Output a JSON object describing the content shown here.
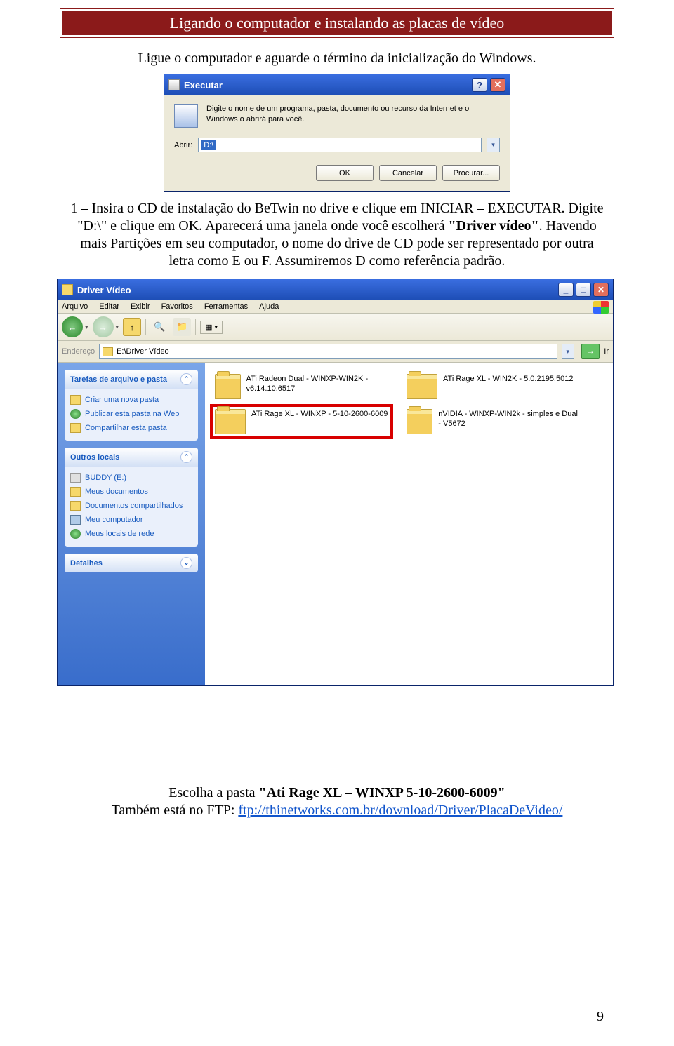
{
  "header": {
    "title": "Ligando o computador e instalando as placas de vídeo"
  },
  "intro": "Ligue o computador e aguarde o término da inicialização do Windows.",
  "run_dialog": {
    "title": "Executar",
    "desc": "Digite o nome de um programa, pasta, documento ou recurso da Internet e o Windows o abrirá para você.",
    "open_label": "Abrir:",
    "open_value": "D:\\",
    "ok": "OK",
    "cancel": "Cancelar",
    "browse": "Procurar..."
  },
  "para1": {
    "line1a": "1 – Insira o CD de instalação do BeTwin no drive e clique em INICIAR – EXECUTAR. Digite \"D:\\\" e clique em OK. Aparecerá uma janela onde você escolherá ",
    "bold1": "\"Driver vídeo\"",
    "line1b": ". Havendo mais Partições em seu computador, o nome do drive de CD pode ser representado por outra letra como E ou F. Assumiremos D como referência padrão."
  },
  "explorer": {
    "title": "Driver Vídeo",
    "menu": [
      "Arquivo",
      "Editar",
      "Exibir",
      "Favoritos",
      "Ferramentas",
      "Ajuda"
    ],
    "addr_label": "Endereço",
    "addr_value": "E:\\Driver Vídeo",
    "go": "Ir",
    "side": {
      "tasks": {
        "title": "Tarefas de arquivo e pasta",
        "items": [
          "Criar uma nova pasta",
          "Publicar esta pasta na Web",
          "Compartilhar esta pasta"
        ]
      },
      "other": {
        "title": "Outros locais",
        "items": [
          "BUDDY (E:)",
          "Meus documentos",
          "Documentos compartilhados",
          "Meu computador",
          "Meus locais de rede"
        ]
      },
      "details": {
        "title": "Detalhes"
      }
    },
    "folders": [
      {
        "name": "ATi Radeon Dual - WINXP-WIN2K - v6.14.10.6517"
      },
      {
        "name": "ATi Rage XL - WIN2K - 5.0.2195.5012"
      },
      {
        "name": "ATi Rage XL - WINXP - 5-10-2600-6009",
        "highlight": true
      },
      {
        "name": "nVIDIA - WINXP-WIN2k - simples e Dual - V5672"
      }
    ]
  },
  "footer": {
    "line1a": "Escolha a pasta ",
    "bold": "\"Ati Rage XL – WINXP 5-10-2600-6009\"",
    "line2": "Também está no FTP: ",
    "link": "ftp://thinetworks.com.br/download/Driver/PlacaDeVideo/"
  },
  "page_number": "9"
}
